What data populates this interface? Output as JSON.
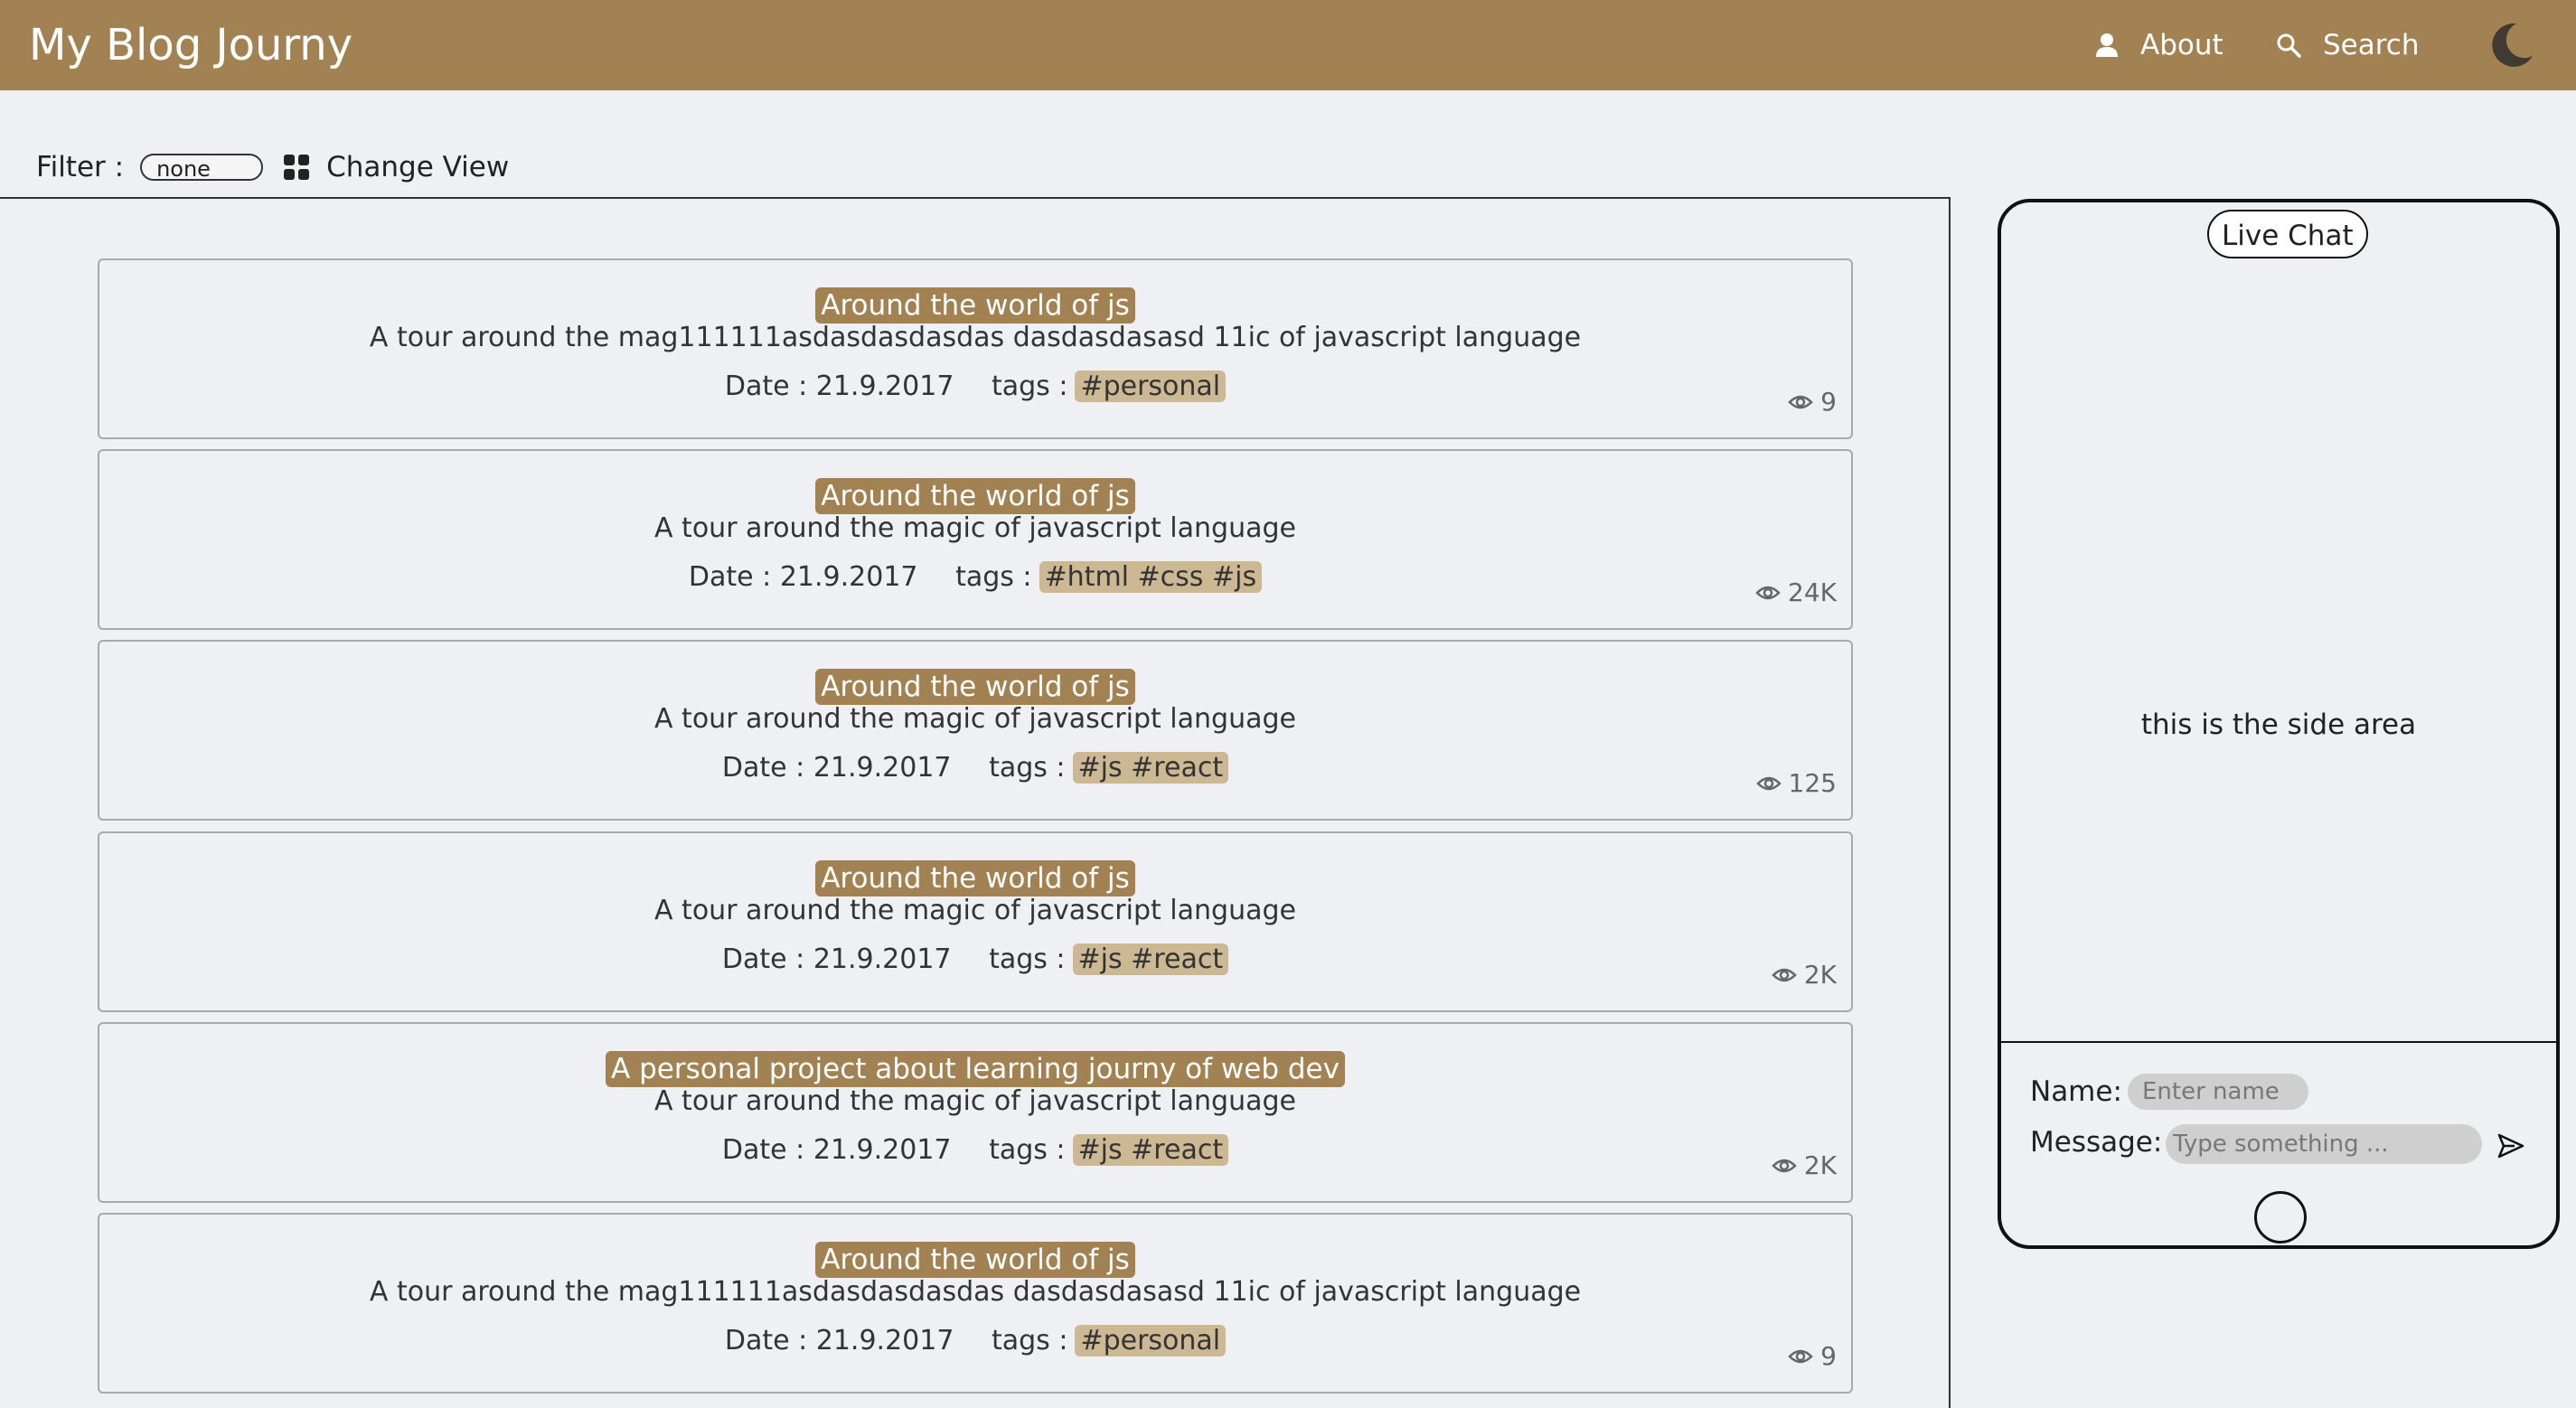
{
  "header": {
    "title": "My Blog Journy",
    "nav": {
      "about": "About",
      "search": "Search"
    },
    "icons": {
      "about": "user-icon",
      "search": "search-icon",
      "theme": "moon-icon"
    },
    "colors": {
      "brand": "#a28252"
    }
  },
  "toolbar": {
    "filter_label": "Filter :",
    "filter_value": "none",
    "change_view_label": "Change View",
    "change_view_icon": "grid-icon"
  },
  "posts": [
    {
      "title": "Around the world of js",
      "description": "A tour around the mag111111asdasdasdasdas dasdasdasasd 11ic of javascript language",
      "date_label": "Date :",
      "date": "21.9.2017",
      "tags_label": "tags :",
      "tags": "#personal",
      "views": "9"
    },
    {
      "title": "Around the world of js",
      "description": "A tour around the magic of javascript language",
      "date_label": "Date :",
      "date": "21.9.2017",
      "tags_label": "tags :",
      "tags": "#html #css #js",
      "views": "24K"
    },
    {
      "title": "Around the world of js",
      "description": "A tour around the magic of javascript language",
      "date_label": "Date :",
      "date": "21.9.2017",
      "tags_label": "tags :",
      "tags": "#js #react",
      "views": "125"
    },
    {
      "title": "Around the world of js",
      "description": "A tour around the magic of javascript language",
      "date_label": "Date :",
      "date": "21.9.2017",
      "tags_label": "tags :",
      "tags": "#js #react",
      "views": "2K"
    },
    {
      "title": "A personal project about learning journy of web dev",
      "description": "A tour around the magic of javascript language",
      "date_label": "Date :",
      "date": "21.9.2017",
      "tags_label": "tags :",
      "tags": "#js #react",
      "views": "2K"
    },
    {
      "title": "Around the world of js",
      "description": "A tour around the mag111111asdasdasdasdas dasdasdasasd 11ic of javascript language",
      "date_label": "Date :",
      "date": "21.9.2017",
      "tags_label": "tags :",
      "tags": "#personal",
      "views": "9"
    }
  ],
  "chat": {
    "title": "Live Chat",
    "side_text": "this is the side area",
    "name_label": "Name:",
    "name_placeholder": "Enter name",
    "message_label": "Message:",
    "message_placeholder": "Type something ...",
    "send_icon": "send-icon"
  }
}
